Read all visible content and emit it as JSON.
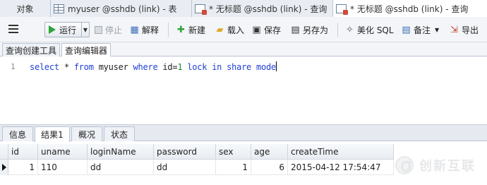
{
  "doc_tabs": {
    "objects": "对象",
    "tab1": "myuser @sshdb (link) - 表",
    "tab2": "* 无标题 @sshdb (link) - 查询",
    "tab3": "* 无标题 @sshdb (link) - 查询"
  },
  "toolbar": {
    "run": "运行",
    "stop": "停止",
    "explain": "解释",
    "new": "新建",
    "load": "载入",
    "save": "保存",
    "save_as": "另存为",
    "beautify": "美化 SQL",
    "note": "备注",
    "export": "导出"
  },
  "editor_tabs": {
    "builder": "查询创建工具",
    "editor": "查询编辑器"
  },
  "editor": {
    "line_number": "1",
    "tokens": [
      "select",
      "*",
      "from",
      "myuser",
      "where",
      "id=",
      "1",
      "lock",
      "in",
      "share",
      "mode"
    ]
  },
  "result_tabs": {
    "info": "信息",
    "result1": "结果1",
    "overview": "概况",
    "status": "状态"
  },
  "grid": {
    "columns": [
      "id",
      "uname",
      "loginName",
      "password",
      "sex",
      "age",
      "createTime"
    ],
    "rows": [
      [
        "1",
        "110",
        "dd",
        "dd",
        "1",
        "6",
        "2015-04-12 17:54:47"
      ]
    ]
  },
  "watermark": {
    "text": "创新互联"
  },
  "colors": {
    "keyword": "#1f3fd6",
    "number": "#1a8f2a",
    "run_green": "#2fa33a"
  }
}
